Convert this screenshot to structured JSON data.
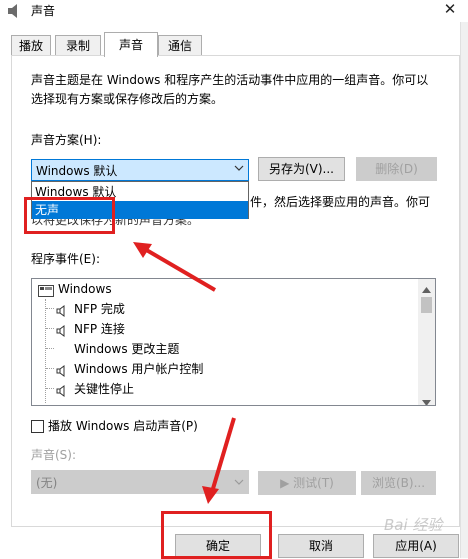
{
  "window": {
    "title": "声音",
    "close_glyph": "✕"
  },
  "tabs": [
    {
      "label": "播放"
    },
    {
      "label": "录制"
    },
    {
      "label": "声音"
    },
    {
      "label": "通信"
    }
  ],
  "intro": {
    "line1": "声音主题是在 Windows 和程序产生的活动事件中应用的一组声音。你可以",
    "line2": "选择现有方案或保存修改后的方案。"
  },
  "scheme": {
    "label": "声音方案(H):",
    "selected": "Windows 默认",
    "save_as_button": "另存为(V)...",
    "delete_button": "删除(D)",
    "options": [
      "Windows 默认",
      "无声"
    ]
  },
  "behind_text": {
    "line1_tail": "件，然后选择要应用的声音。你可",
    "line2": "以将更改保存为新的声音方案。"
  },
  "events": {
    "label": "程序事件(E):",
    "items": [
      {
        "label": "Windows",
        "type": "group"
      },
      {
        "label": "NFP 完成",
        "type": "sound"
      },
      {
        "label": "NFP 连接",
        "type": "sound"
      },
      {
        "label": "Windows 更改主题",
        "type": "none"
      },
      {
        "label": "Windows 用户帐户控制",
        "type": "sound"
      },
      {
        "label": "关键性停止",
        "type": "sound"
      }
    ]
  },
  "startup_checkbox": {
    "label": "播放 Windows 启动声音(P)",
    "checked": false
  },
  "sound": {
    "label": "声音(S):",
    "value": "(无)",
    "test_button": "▶ 测试(T)",
    "browse_button": "浏览(B)..."
  },
  "footer": {
    "ok_button": "确定",
    "cancel_button": "取消",
    "apply_button": "应用(A)"
  },
  "watermark": "Bai 经验",
  "colors": {
    "accent": "#0078d7",
    "annotation_red": "#e02020"
  }
}
